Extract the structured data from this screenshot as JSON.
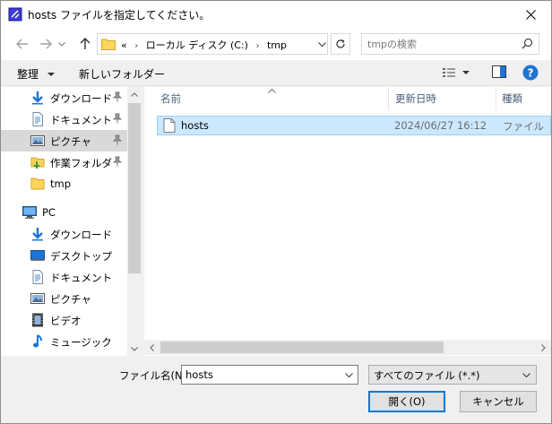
{
  "window": {
    "title": "hosts ファイルを指定してください。"
  },
  "address_bar": {
    "overflow": "«",
    "crumbs": [
      "ローカル ディスク (C:)",
      "tmp"
    ]
  },
  "search": {
    "placeholder": "tmpの検索"
  },
  "toolbar": {
    "organize": "整理",
    "new_folder": "新しいフォルダー"
  },
  "nav": {
    "quick_access": [
      {
        "label": "ダウンロード",
        "icon": "download-arrow-icon",
        "pinned": true
      },
      {
        "label": "ドキュメント",
        "icon": "document-icon",
        "pinned": true
      },
      {
        "label": "ピクチャ",
        "icon": "pictures-icon",
        "pinned": true,
        "selected": true
      },
      {
        "label": "作業フォルダ",
        "icon": "work-folder-icon",
        "pinned": true
      },
      {
        "label": "tmp",
        "icon": "folder-icon",
        "pinned": false
      }
    ],
    "pc_label": "PC",
    "pc_items": [
      {
        "label": "ダウンロード",
        "icon": "download-arrow-icon"
      },
      {
        "label": "デスクトップ",
        "icon": "desktop-icon"
      },
      {
        "label": "ドキュメント",
        "icon": "document-icon"
      },
      {
        "label": "ピクチャ",
        "icon": "pictures-icon"
      },
      {
        "label": "ビデオ",
        "icon": "video-icon"
      },
      {
        "label": "ミュージック",
        "icon": "music-icon"
      }
    ]
  },
  "columns": {
    "name": "名前",
    "modified": "更新日時",
    "type": "種類"
  },
  "files": [
    {
      "name": "hosts",
      "modified": "2024/06/27 16:12",
      "type": "ファイル",
      "selected": true
    }
  ],
  "footer": {
    "filename_label": "ファイル名(N):",
    "filename_value": "hosts",
    "filetype_value": "すべてのファイル (*.*)",
    "open_label": "開く(O)",
    "cancel_label": "キャンセル"
  },
  "colors": {
    "selection_bg": "#cce8ff",
    "selection_border": "#99d1ff",
    "accent": "#0078d7",
    "help_icon": "#1e74d6"
  }
}
